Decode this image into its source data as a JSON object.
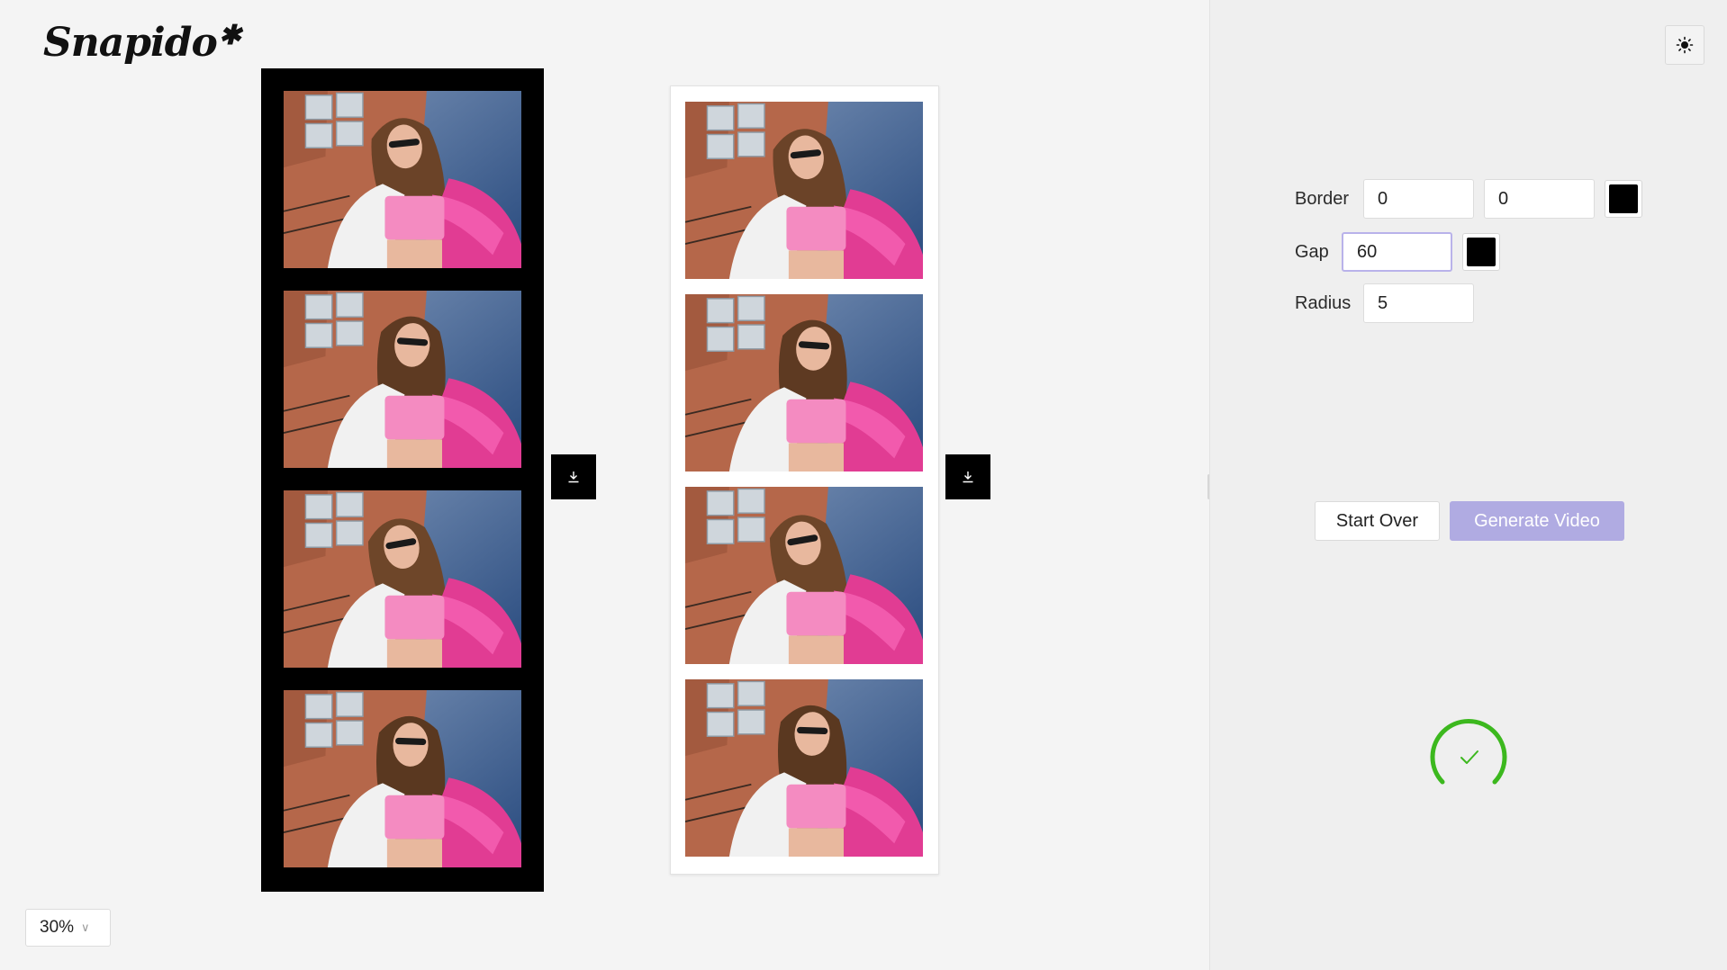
{
  "app": {
    "logo_text": "Snapido",
    "logo_star": "✱"
  },
  "canvas": {
    "zoom": {
      "value": "30%"
    },
    "strips": [
      {
        "name": "black-strip",
        "background": "#000000",
        "photo_count": 4,
        "download_icon": "download-icon"
      },
      {
        "name": "white-strip",
        "background": "#ffffff",
        "photo_count": 4,
        "download_icon": "download-icon"
      }
    ]
  },
  "toolbar": {
    "theme_icon": "sun-icon"
  },
  "settings": {
    "border": {
      "label": "Border",
      "value1": "0",
      "value2": "0",
      "color": "#000000"
    },
    "gap": {
      "label": "Gap",
      "value": "60",
      "color": "#000000"
    },
    "radius": {
      "label": "Radius",
      "value": "5"
    }
  },
  "actions": {
    "start_over_label": "Start Over",
    "generate_label": "Generate Video"
  },
  "status": {
    "icon": "check-icon",
    "color": "#3cb81e"
  },
  "colors": {
    "accent": "#b0abe2",
    "success": "#3cb81e"
  }
}
